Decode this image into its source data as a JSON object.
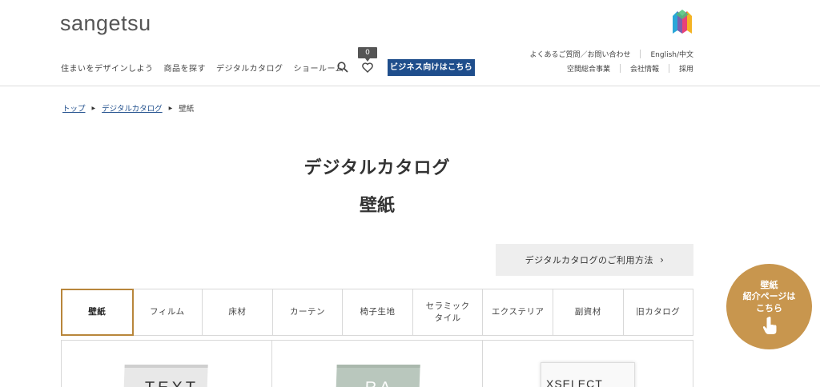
{
  "header": {
    "logo": "sangetsu",
    "nav": [
      "住まいをデザインしよう",
      "商品を探す",
      "デジタルカタログ",
      "ショールーム"
    ],
    "favorites_count": "0",
    "business_button": "ビジネス向けはこちら",
    "util_top": [
      "よくあるご質問／お問い合わせ",
      "English/中文"
    ],
    "util_bottom": [
      "空間総合事業",
      "会社情報",
      "採用"
    ]
  },
  "breadcrumb": [
    "トップ",
    "デジタルカタログ",
    "壁紙"
  ],
  "page": {
    "title": "デジタルカタログ",
    "subtitle": "壁紙",
    "howto_button": "デジタルカタログのご利用方法"
  },
  "tabs": [
    "壁紙",
    "フィルム",
    "床材",
    "カーテン",
    "椅子生地",
    "セラミック\nタイル",
    "エクステリア",
    "副資材",
    "旧カタログ"
  ],
  "catalogs": [
    "TEXT",
    "RA",
    "XSELECT"
  ],
  "float_button": {
    "line1": "壁紙",
    "line2": "紹介ページは",
    "line3": "こちら"
  },
  "colors": {
    "business_blue": "#1f4e8c",
    "accent_gold": "#b8863b",
    "float_orange": "#c8964e"
  }
}
